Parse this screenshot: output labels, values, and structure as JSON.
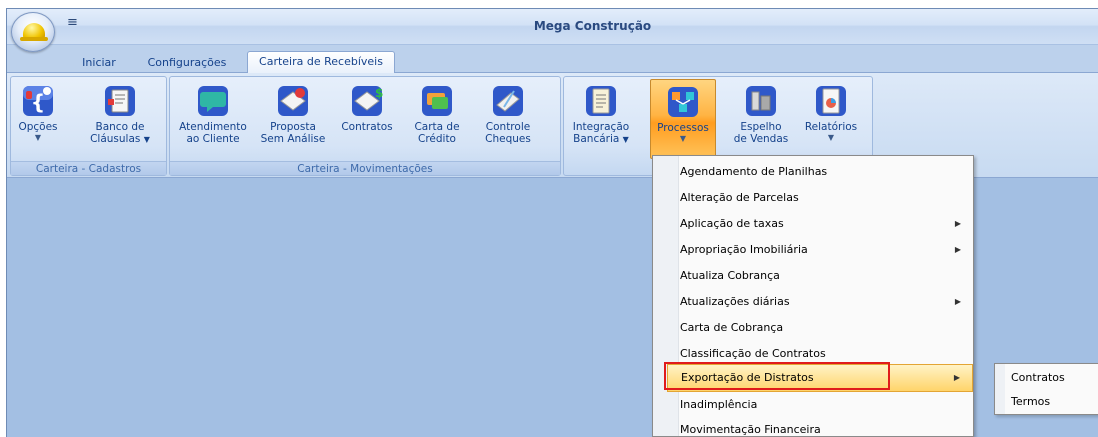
{
  "window": {
    "title": "Mega Construção",
    "qat_symbol": "≡"
  },
  "tabs": [
    {
      "label": "Iniciar"
    },
    {
      "label": "Configurações"
    },
    {
      "label": "Carteira de Recebíveis"
    }
  ],
  "groups": {
    "cadastros": {
      "label": "Carteira - Cadastros",
      "buttons": [
        {
          "line1": "Opções",
          "line2": "",
          "icon": "options-icon"
        },
        {
          "line1": "Banco de",
          "line2": "Cláusulas",
          "icon": "clauses-icon"
        }
      ]
    },
    "movimentacoes": {
      "label": "Carteira - Movimentações",
      "buttons": [
        {
          "line1": "Atendimento",
          "line2": "ao Cliente",
          "icon": "chat-icon"
        },
        {
          "line1": "Proposta",
          "line2": "Sem Análise",
          "icon": "proposal-icon"
        },
        {
          "line1": "Contratos",
          "line2": "",
          "icon": "contracts-icon"
        },
        {
          "line1": "Carta de",
          "line2": "Crédito",
          "icon": "credit-letter-icon"
        },
        {
          "line1": "Controle",
          "line2": "Cheques",
          "icon": "checks-icon"
        }
      ]
    },
    "misc": {
      "buttons": [
        {
          "line1": "Integração",
          "line2": "Bancária",
          "icon": "bank-integration-icon"
        },
        {
          "line1": "Processos",
          "line2": "",
          "icon": "processes-icon"
        },
        {
          "line1": "Espelho",
          "line2": "de Vendas",
          "icon": "sales-mirror-icon"
        },
        {
          "line1": "Relatórios",
          "line2": "",
          "icon": "reports-icon"
        }
      ]
    }
  },
  "menu": {
    "items": [
      {
        "label": "Agendamento de Planilhas",
        "submenu": false
      },
      {
        "label": "Alteração de Parcelas",
        "submenu": false
      },
      {
        "label": "Aplicação de taxas",
        "submenu": true
      },
      {
        "label": "Apropriação Imobiliária",
        "submenu": true
      },
      {
        "label": "Atualiza Cobrança",
        "submenu": false
      },
      {
        "label": "Atualizações diárias",
        "submenu": true
      },
      {
        "label": "Carta de Cobrança",
        "submenu": false
      },
      {
        "label": "Classificação de Contratos",
        "submenu": false
      },
      {
        "label": "Exportação de Distratos",
        "submenu": true
      },
      {
        "label": "Inadimplência",
        "submenu": false
      },
      {
        "label": "Movimentação Financeira",
        "submenu": false
      }
    ],
    "highlighted_index": 8,
    "arrow_symbol": "▶"
  },
  "submenu": {
    "items": [
      {
        "label": "Contratos"
      },
      {
        "label": "Termos"
      }
    ]
  },
  "colors": {
    "workspace": "#a3bfe3",
    "highlight_box": "#e01b1b",
    "pressed_button": "#ffb444"
  }
}
